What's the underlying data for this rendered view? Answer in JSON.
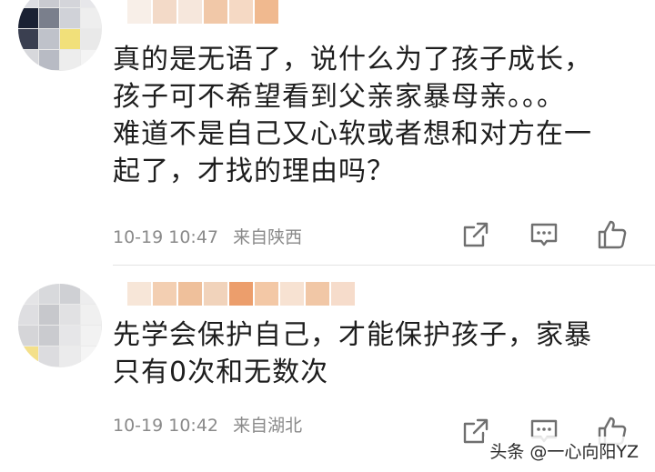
{
  "comments": [
    {
      "text": "真的是无语了，说什么为了孩子成长，\n孩子可不希望看到父亲家暴母亲。。。\n难道不是自己又心软或者想和对方在一\n起了，才找的理由吗？",
      "time": "10-19 10:47",
      "location": "来自陕西",
      "avatar_colors": [
        "#dcdde2",
        "#c9cad0",
        "#d4d5da",
        "#e7e7ea",
        "#1a2133",
        "#7a7f8c",
        "#d0d2d8",
        "#eeeeee",
        "#3a3f50",
        "#bfc2ca",
        "#f1e07a",
        "#e9e9e9",
        "#d7d8dc",
        "#b8bbc4",
        "#ededed",
        "#f4f4f4"
      ],
      "name_colors": [
        "#f8efe8",
        "#f3dac8",
        "#f6e7dc",
        "#f1c8a8",
        "#f5d9c4",
        "#f0b98f"
      ]
    },
    {
      "text": "先学会保护自己，才能保护孩子，家暴\n只有0次和无数次",
      "time": "10-19 10:42",
      "location": "来自湖北",
      "avatar_colors": [
        "#e4e4e6",
        "#d8d9dc",
        "#cfd0d4",
        "#ededee",
        "#dedee1",
        "#c7c8cc",
        "#e1e1e3",
        "#f0f0f0",
        "#d5d5d8",
        "#cacbcf",
        "#e6e6e8",
        "#f2f2f2",
        "#f4e08a",
        "#dcdcdf",
        "#ebebec",
        "#f5f5f5"
      ],
      "name_colors": [
        "#f7e6d8",
        "#f3cfb2",
        "#efc09b",
        "#f1d3bb",
        "#ec9e6c",
        "#f3c8a6",
        "#f7e2d2",
        "#f1c7a6",
        "#f6dccb"
      ]
    }
  ],
  "icons": {
    "share": "share-icon",
    "reply": "comment-icon",
    "like": "thumbs-up-icon"
  },
  "watermark": "头条 @一心向阳YZ"
}
